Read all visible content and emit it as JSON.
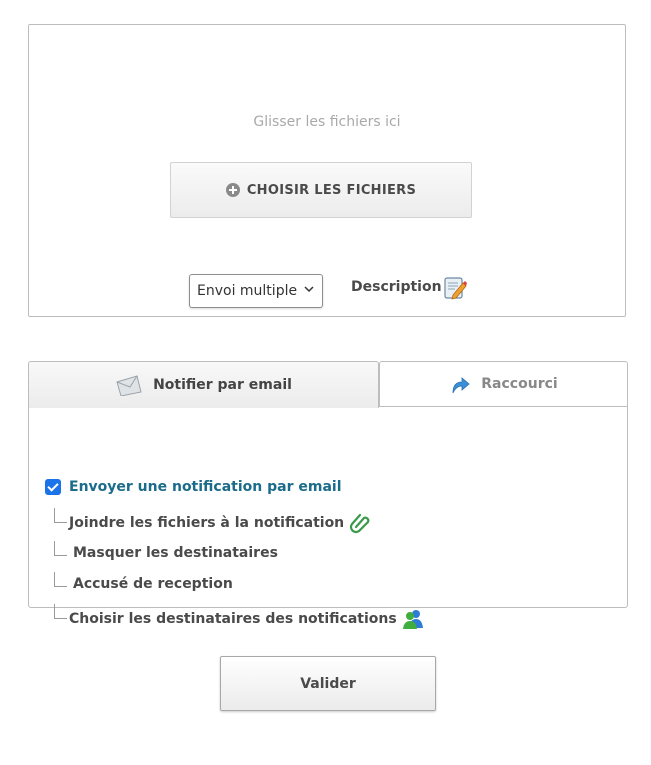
{
  "upload": {
    "drop_hint": "Glisser les fichiers ici",
    "choose_label": "CHOISIR LES FICHIERS",
    "mode_select_value": "Envoi multiple",
    "description_label": "Description"
  },
  "tabs": [
    {
      "label": "Notifier par email",
      "icon": "envelope-icon",
      "active": true
    },
    {
      "label": "Raccourci",
      "icon": "share-arrow-icon",
      "active": false
    }
  ],
  "notify": {
    "main_label": "Envoyer une notification par email",
    "checked": true,
    "options": [
      {
        "label": "Joindre les fichiers à la notification",
        "icon": "paperclip-icon"
      },
      {
        "label": "Masquer les destinataires"
      },
      {
        "label": "Accusé de reception"
      },
      {
        "label": "Choisir les destinataires des notifications",
        "icon": "users-icon"
      }
    ]
  },
  "actions": {
    "validate_label": "Valider"
  },
  "colors": {
    "accent_blue": "#1a73e8",
    "link_teal": "#1b6b8a"
  }
}
